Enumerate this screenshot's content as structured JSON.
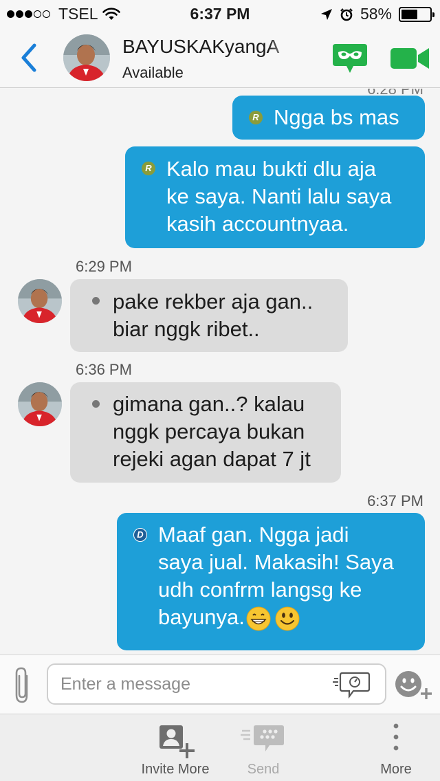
{
  "status_bar": {
    "carrier": "TSEL",
    "time": "6:37 PM",
    "battery": "58%",
    "battery_level": 0.58,
    "signal_bars_filled": 3,
    "signal_bars_total": 5
  },
  "header": {
    "contact_name": "BAYUSKAKyangA",
    "contact_status": "Available",
    "accent_color": "#1a7fd8",
    "call_icon_color": "#24b24a"
  },
  "messages": {
    "peek_time": "6:28 PM",
    "m1": {
      "text": "Ngga bs mas",
      "status": "R"
    },
    "m2": {
      "text": "Kalo mau bukti dlu aja\nke saya. Nanti lalu saya\nkasih accountnyaa.",
      "status": "R"
    },
    "m3": {
      "time": "6:29 PM",
      "text": "pake rekber aja gan..\nbiar nggk ribet.."
    },
    "m4": {
      "time": "6:36 PM",
      "text": "gimana gan..? kalau\nnggk percaya bukan\nrejeki agan dapat 7 jt"
    },
    "m5": {
      "time": "6:37 PM",
      "text": "Maaf gan. Ngga jadi\nsaya jual. Makasih! Saya\nudh confrm langsg ke\nbayunya.",
      "status": "D",
      "emojis": [
        "grinning-face-emoji",
        "smiling-face-emoji"
      ]
    },
    "outgoing_color": "#1e9fd8",
    "incoming_color": "#dcdcdc"
  },
  "composer": {
    "placeholder": "Enter a message"
  },
  "tabbar": {
    "invite_more": "Invite More",
    "send": "Send",
    "more": "More"
  }
}
